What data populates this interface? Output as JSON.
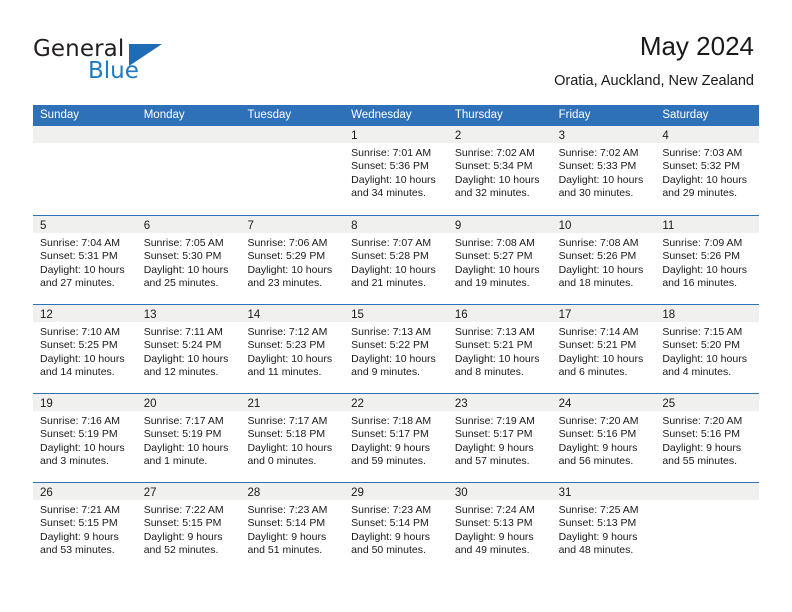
{
  "brand": {
    "name_top": "General",
    "name_bottom": "Blue",
    "triangle_color": "#1f6cb5",
    "blue_text_color": "#1f7bc1"
  },
  "header": {
    "title": "May 2024",
    "subtitle": "Oratia, Auckland, New Zealand"
  },
  "theme": {
    "header_blue": "#2e71b8",
    "daynum_band": "#f0f0ef",
    "text": "#1a1a1a"
  },
  "calendar": {
    "weekday_headers": [
      "Sunday",
      "Monday",
      "Tuesday",
      "Wednesday",
      "Thursday",
      "Friday",
      "Saturday"
    ],
    "weeks": [
      [
        {
          "day": "",
          "lines": []
        },
        {
          "day": "",
          "lines": []
        },
        {
          "day": "",
          "lines": []
        },
        {
          "day": "1",
          "lines": [
            "Sunrise: 7:01 AM",
            "Sunset: 5:36 PM",
            "Daylight: 10 hours",
            "and 34 minutes."
          ]
        },
        {
          "day": "2",
          "lines": [
            "Sunrise: 7:02 AM",
            "Sunset: 5:34 PM",
            "Daylight: 10 hours",
            "and 32 minutes."
          ]
        },
        {
          "day": "3",
          "lines": [
            "Sunrise: 7:02 AM",
            "Sunset: 5:33 PM",
            "Daylight: 10 hours",
            "and 30 minutes."
          ]
        },
        {
          "day": "4",
          "lines": [
            "Sunrise: 7:03 AM",
            "Sunset: 5:32 PM",
            "Daylight: 10 hours",
            "and 29 minutes."
          ]
        }
      ],
      [
        {
          "day": "5",
          "lines": [
            "Sunrise: 7:04 AM",
            "Sunset: 5:31 PM",
            "Daylight: 10 hours",
            "and 27 minutes."
          ]
        },
        {
          "day": "6",
          "lines": [
            "Sunrise: 7:05 AM",
            "Sunset: 5:30 PM",
            "Daylight: 10 hours",
            "and 25 minutes."
          ]
        },
        {
          "day": "7",
          "lines": [
            "Sunrise: 7:06 AM",
            "Sunset: 5:29 PM",
            "Daylight: 10 hours",
            "and 23 minutes."
          ]
        },
        {
          "day": "8",
          "lines": [
            "Sunrise: 7:07 AM",
            "Sunset: 5:28 PM",
            "Daylight: 10 hours",
            "and 21 minutes."
          ]
        },
        {
          "day": "9",
          "lines": [
            "Sunrise: 7:08 AM",
            "Sunset: 5:27 PM",
            "Daylight: 10 hours",
            "and 19 minutes."
          ]
        },
        {
          "day": "10",
          "lines": [
            "Sunrise: 7:08 AM",
            "Sunset: 5:26 PM",
            "Daylight: 10 hours",
            "and 18 minutes."
          ]
        },
        {
          "day": "11",
          "lines": [
            "Sunrise: 7:09 AM",
            "Sunset: 5:26 PM",
            "Daylight: 10 hours",
            "and 16 minutes."
          ]
        }
      ],
      [
        {
          "day": "12",
          "lines": [
            "Sunrise: 7:10 AM",
            "Sunset: 5:25 PM",
            "Daylight: 10 hours",
            "and 14 minutes."
          ]
        },
        {
          "day": "13",
          "lines": [
            "Sunrise: 7:11 AM",
            "Sunset: 5:24 PM",
            "Daylight: 10 hours",
            "and 12 minutes."
          ]
        },
        {
          "day": "14",
          "lines": [
            "Sunrise: 7:12 AM",
            "Sunset: 5:23 PM",
            "Daylight: 10 hours",
            "and 11 minutes."
          ]
        },
        {
          "day": "15",
          "lines": [
            "Sunrise: 7:13 AM",
            "Sunset: 5:22 PM",
            "Daylight: 10 hours",
            "and 9 minutes."
          ]
        },
        {
          "day": "16",
          "lines": [
            "Sunrise: 7:13 AM",
            "Sunset: 5:21 PM",
            "Daylight: 10 hours",
            "and 8 minutes."
          ]
        },
        {
          "day": "17",
          "lines": [
            "Sunrise: 7:14 AM",
            "Sunset: 5:21 PM",
            "Daylight: 10 hours",
            "and 6 minutes."
          ]
        },
        {
          "day": "18",
          "lines": [
            "Sunrise: 7:15 AM",
            "Sunset: 5:20 PM",
            "Daylight: 10 hours",
            "and 4 minutes."
          ]
        }
      ],
      [
        {
          "day": "19",
          "lines": [
            "Sunrise: 7:16 AM",
            "Sunset: 5:19 PM",
            "Daylight: 10 hours",
            "and 3 minutes."
          ]
        },
        {
          "day": "20",
          "lines": [
            "Sunrise: 7:17 AM",
            "Sunset: 5:19 PM",
            "Daylight: 10 hours",
            "and 1 minute."
          ]
        },
        {
          "day": "21",
          "lines": [
            "Sunrise: 7:17 AM",
            "Sunset: 5:18 PM",
            "Daylight: 10 hours",
            "and 0 minutes."
          ]
        },
        {
          "day": "22",
          "lines": [
            "Sunrise: 7:18 AM",
            "Sunset: 5:17 PM",
            "Daylight: 9 hours",
            "and 59 minutes."
          ]
        },
        {
          "day": "23",
          "lines": [
            "Sunrise: 7:19 AM",
            "Sunset: 5:17 PM",
            "Daylight: 9 hours",
            "and 57 minutes."
          ]
        },
        {
          "day": "24",
          "lines": [
            "Sunrise: 7:20 AM",
            "Sunset: 5:16 PM",
            "Daylight: 9 hours",
            "and 56 minutes."
          ]
        },
        {
          "day": "25",
          "lines": [
            "Sunrise: 7:20 AM",
            "Sunset: 5:16 PM",
            "Daylight: 9 hours",
            "and 55 minutes."
          ]
        }
      ],
      [
        {
          "day": "26",
          "lines": [
            "Sunrise: 7:21 AM",
            "Sunset: 5:15 PM",
            "Daylight: 9 hours",
            "and 53 minutes."
          ]
        },
        {
          "day": "27",
          "lines": [
            "Sunrise: 7:22 AM",
            "Sunset: 5:15 PM",
            "Daylight: 9 hours",
            "and 52 minutes."
          ]
        },
        {
          "day": "28",
          "lines": [
            "Sunrise: 7:23 AM",
            "Sunset: 5:14 PM",
            "Daylight: 9 hours",
            "and 51 minutes."
          ]
        },
        {
          "day": "29",
          "lines": [
            "Sunrise: 7:23 AM",
            "Sunset: 5:14 PM",
            "Daylight: 9 hours",
            "and 50 minutes."
          ]
        },
        {
          "day": "30",
          "lines": [
            "Sunrise: 7:24 AM",
            "Sunset: 5:13 PM",
            "Daylight: 9 hours",
            "and 49 minutes."
          ]
        },
        {
          "day": "31",
          "lines": [
            "Sunrise: 7:25 AM",
            "Sunset: 5:13 PM",
            "Daylight: 9 hours",
            "and 48 minutes."
          ]
        },
        {
          "day": "",
          "lines": []
        }
      ]
    ]
  }
}
